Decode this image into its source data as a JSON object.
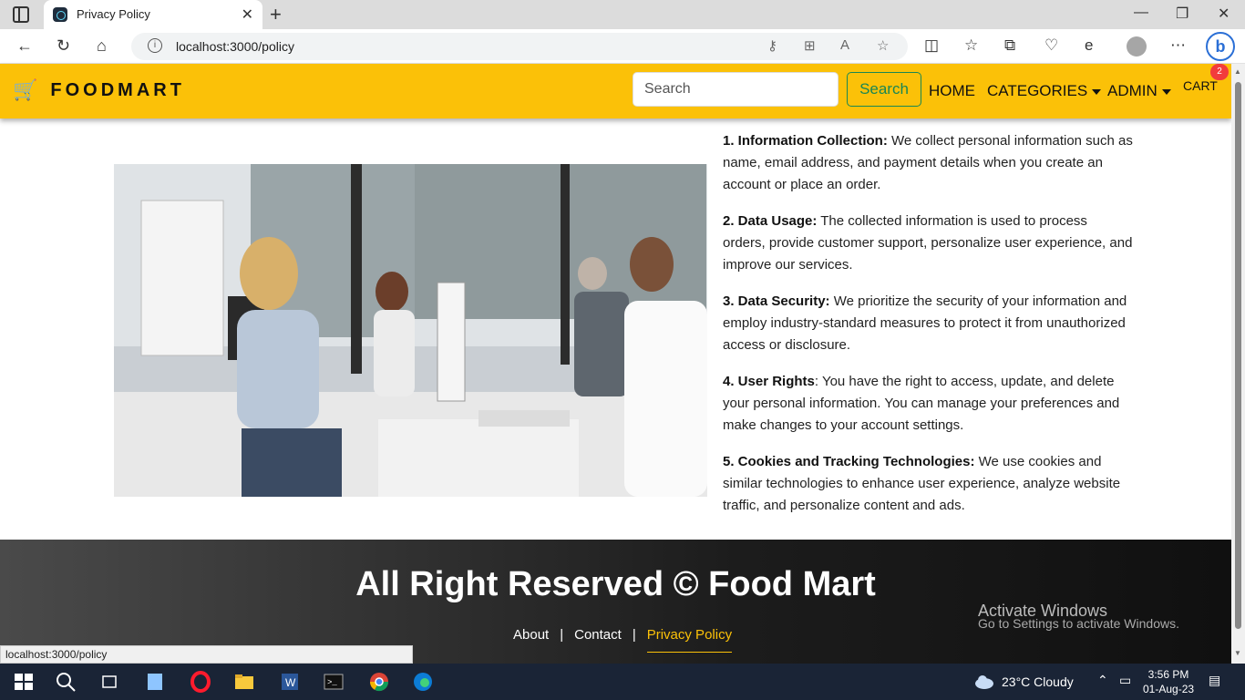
{
  "browser": {
    "tab_title": "Privacy Policy",
    "url": "localhost:3000/policy",
    "status_url": "localhost:3000/policy"
  },
  "header": {
    "brand": "FOODMART",
    "search_placeholder": "Search",
    "search_button": "Search",
    "nav": {
      "home": "HOME",
      "categories": "CATEGORIES",
      "admin": "ADMIN",
      "cart": "CART",
      "cart_count": "2"
    }
  },
  "policy": [
    {
      "title": "1. Information Collection:",
      "text": " We collect personal information such as name, email address, and payment details when you create an account or place an order."
    },
    {
      "title": "2. Data Usage:",
      "text": " The collected information is used to process orders, provide customer support, personalize user experience, and improve our services."
    },
    {
      "title": "3. Data Security:",
      "text": " We prioritize the security of your information and employ industry-standard measures to protect it from unauthorized access or disclosure."
    },
    {
      "title": "4. User Rights",
      "text": ": You have the right to access, update, and delete your personal information. You can manage your preferences and make changes to your account settings."
    },
    {
      "title": "5. Cookies and Tracking Technologies:",
      "text": " We use cookies and similar technologies to enhance user experience, analyze website traffic, and personalize content and ads."
    }
  ],
  "footer": {
    "title": "All Right Reserved © Food Mart",
    "links": {
      "about": "About",
      "sep1": "|",
      "contact": "Contact",
      "sep2": "|",
      "privacy": "Privacy Policy"
    }
  },
  "windows_watermark": {
    "title": "Activate Windows",
    "subtitle": "Go to Settings to activate Windows."
  },
  "taskbar": {
    "weather": "23°C  Cloudy",
    "time": "3:56 PM",
    "date": "01-Aug-23"
  },
  "colors": {
    "header_bg": "#fbc108",
    "search_green": "#198754",
    "footer_dark": "#1c1c1c",
    "active_link": "#fbc108",
    "badge_red": "#f23c3c"
  }
}
